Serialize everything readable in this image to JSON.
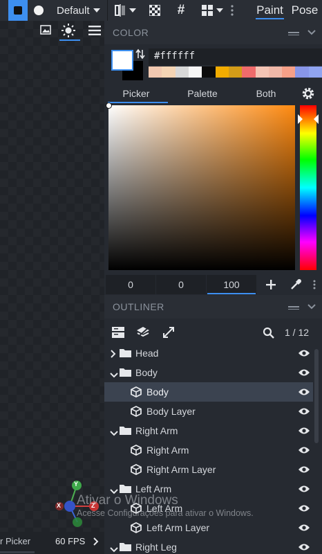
{
  "toolbar": {
    "layout_select": "Default",
    "mode_paint": "Paint",
    "mode_pose": "Pose"
  },
  "color_panel": {
    "title": "COLOR",
    "hex_value": "#ffffff",
    "palette_swatches": [
      "#f1c8b0",
      "#f4d4b4",
      "#d8d8d8",
      "#f6f6f6",
      "#0c0c0c",
      "#f2ac00",
      "#d39c18",
      "#ef6b6b",
      "#f4c4b4",
      "#f0b8a8",
      "#f6a088",
      "#8896e8",
      "#90a4f0"
    ],
    "tabs": {
      "picker": "Picker",
      "palette": "Palette",
      "both": "Both"
    },
    "hue_color": "#ff8a10",
    "fields": {
      "a": "0",
      "b": "0",
      "c": "100"
    }
  },
  "outliner": {
    "title": "OUTLINER",
    "counter": "1 / 12",
    "rows": [
      {
        "label": "Head",
        "kind": "group",
        "expanded": false
      },
      {
        "label": "Body",
        "kind": "group",
        "expanded": true
      },
      {
        "label": "Body",
        "kind": "cube",
        "selected": true
      },
      {
        "label": "Body Layer",
        "kind": "cube"
      },
      {
        "label": "Right Arm",
        "kind": "group",
        "expanded": true
      },
      {
        "label": "Right Arm",
        "kind": "cube"
      },
      {
        "label": "Right Arm Layer",
        "kind": "cube"
      },
      {
        "label": "Left Arm",
        "kind": "group",
        "expanded": true
      },
      {
        "label": "Left Arm",
        "kind": "cube"
      },
      {
        "label": "Left Arm Layer",
        "kind": "cube"
      },
      {
        "label": "Right Leg",
        "kind": "group",
        "expanded": true
      }
    ]
  },
  "status": {
    "tool": "r Picker",
    "fps": "60 FPS"
  },
  "watermark": {
    "title": "Ativar o Windows",
    "subtitle": "Acesse Configurações para ativar o Windows."
  },
  "gizmo": {
    "x": "X",
    "y": "Y",
    "z": "Z"
  }
}
